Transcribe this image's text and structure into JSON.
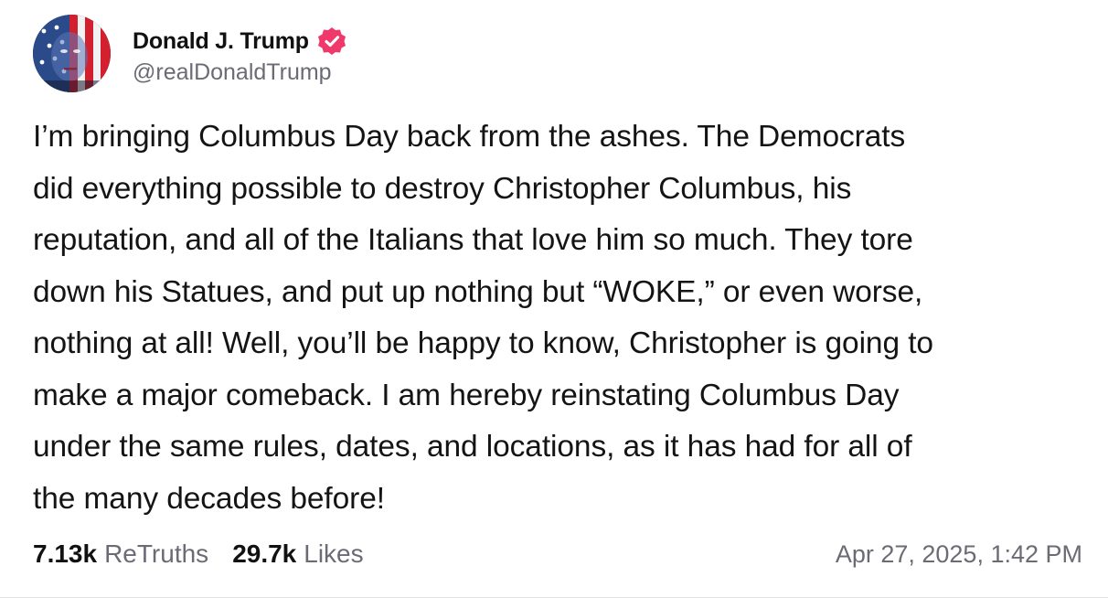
{
  "author": {
    "display_name": "Donald J. Trump",
    "handle": "@realDonaldTrump",
    "verified_icon": "verified-badge-icon",
    "badge_color": "#f0396a"
  },
  "post": {
    "text": "I’m bringing Columbus Day back from the ashes. The Democrats\ndid everything possible to destroy Christopher Columbus, his\nreputation, and all of the Italians that love him so much. They tore\ndown his Statues, and put up nothing but “WOKE,” or even worse,\nnothing at all! Well, you’ll be happy to know, Christopher is going to\nmake a major comeback. I am hereby reinstating Columbus Day\nunder the same rules, dates, and locations, as it has had for all of\nthe many decades before!"
  },
  "stats": {
    "retruths_count": "7.13k",
    "retruths_label": "ReTruths",
    "likes_count": "29.7k",
    "likes_label": "Likes"
  },
  "timestamp": "Apr 27, 2025, 1:42 PM"
}
